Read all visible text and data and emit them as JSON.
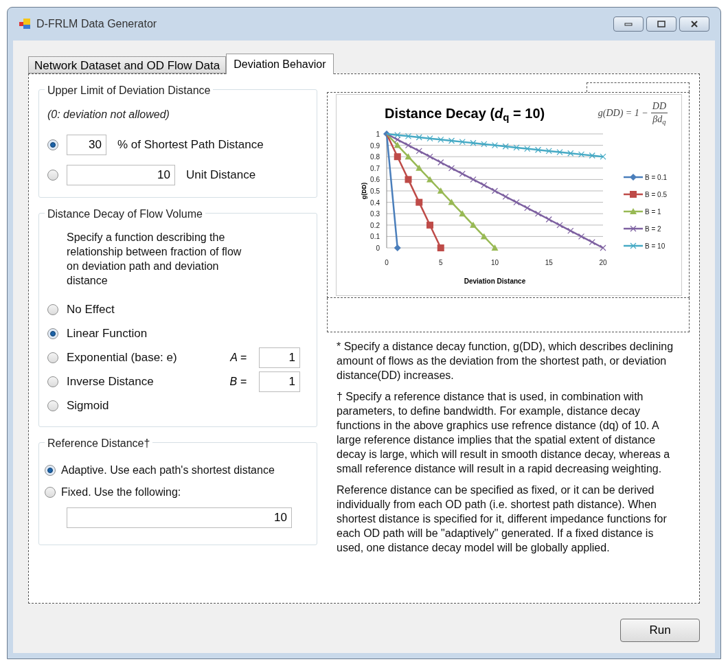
{
  "window": {
    "title": "D-FRLM Data Generator"
  },
  "tabs": [
    {
      "label": "Network Dataset and OD Flow Data",
      "selected": false
    },
    {
      "label": "Deviation Behavior",
      "selected": true
    }
  ],
  "upper_limit": {
    "title": "Upper Limit of Deviation Distance",
    "note": "(0: deviation not allowed)",
    "options": [
      {
        "selected": true,
        "value": "30",
        "label": "% of Shortest Path Distance"
      },
      {
        "selected": false,
        "value": "10",
        "label": "Unit Distance"
      }
    ]
  },
  "distance_decay": {
    "title": "Distance Decay of Flow Volume",
    "description": "Specify a function describing the relationship between fraction of flow on deviation path and deviation distance",
    "options": [
      {
        "label": "No Effect",
        "selected": false
      },
      {
        "label": "Linear Function",
        "selected": true
      },
      {
        "label": "Exponential (base: e)",
        "selected": false
      },
      {
        "label": "Inverse Distance",
        "selected": false
      },
      {
        "label": "Sigmoid",
        "selected": false
      }
    ],
    "parameters": [
      {
        "label": "A =",
        "value": "1"
      },
      {
        "label": "B =",
        "value": "1"
      }
    ]
  },
  "reference_distance": {
    "title": "Reference Distance†",
    "options": [
      {
        "label": "Adaptive. Use each path's shortest distance",
        "selected": true
      },
      {
        "label": "Fixed. Use the following:",
        "selected": false
      }
    ],
    "value": "10"
  },
  "chart": {
    "formula": {
      "lhs": "g(DD) = 1 −",
      "numerator": "DD",
      "denominator": "βd$_{q}$"
    },
    "chart_data": {
      "type": "line",
      "title": "Distance Decay (*d*$_{q}$ = 10)",
      "xlabel": "Deviation Distance",
      "ylabel": "g(DD)",
      "x": [
        0,
        1,
        2,
        3,
        4,
        5,
        6,
        7,
        8,
        9,
        10,
        11,
        12,
        13,
        14,
        15,
        16,
        17,
        18,
        19,
        20
      ],
      "series": [
        {
          "name": "B = 0.1",
          "color": "#4a7ebb",
          "marker": "diamond",
          "values": [
            1,
            0,
            null,
            null,
            null,
            null,
            null,
            null,
            null,
            null,
            null,
            null,
            null,
            null,
            null,
            null,
            null,
            null,
            null,
            null,
            null
          ]
        },
        {
          "name": "B = 0.5",
          "color": "#be4b48",
          "marker": "square",
          "values": [
            1,
            0.8,
            0.6,
            0.4,
            0.2,
            0,
            null,
            null,
            null,
            null,
            null,
            null,
            null,
            null,
            null,
            null,
            null,
            null,
            null,
            null,
            null
          ]
        },
        {
          "name": "B = 1",
          "color": "#98b954",
          "marker": "triangle",
          "values": [
            1,
            0.9,
            0.8,
            0.7,
            0.6,
            0.5,
            0.4,
            0.3,
            0.2,
            0.1,
            0,
            null,
            null,
            null,
            null,
            null,
            null,
            null,
            null,
            null,
            null
          ]
        },
        {
          "name": "B = 2",
          "color": "#7d60a0",
          "marker": "cross",
          "values": [
            1,
            0.95,
            0.9,
            0.85,
            0.8,
            0.75,
            0.7,
            0.65,
            0.6,
            0.55,
            0.5,
            0.45,
            0.4,
            0.35,
            0.3,
            0.25,
            0.2,
            0.15,
            0.1,
            0.05,
            0
          ]
        },
        {
          "name": "B = 10",
          "color": "#46aac5",
          "marker": "cross",
          "values": [
            1,
            0.99,
            0.98,
            0.97,
            0.96,
            0.95,
            0.94,
            0.93,
            0.92,
            0.91,
            0.9,
            0.89,
            0.88,
            0.87,
            0.86,
            0.85,
            0.84,
            0.83,
            0.82,
            0.81,
            0.8
          ]
        }
      ],
      "grid": true,
      "legend": true,
      "xlim": [
        0,
        20
      ],
      "ylim": [
        0,
        1
      ],
      "xticks": [
        0,
        5,
        10,
        15,
        20
      ],
      "yticks": [
        0,
        0.1,
        0.2,
        0.3,
        0.4,
        0.5,
        0.6,
        0.7,
        0.8,
        0.9,
        1
      ]
    }
  },
  "notes": [
    "* Specify a distance decay function, g(DD), which describes declining amount of flows as the deviation from the shortest path, or deviation distance(DD) increases.",
    "† Specify a reference distance that is used, in combination with parameters, to define bandwidth. For example, distance decay functions in the above graphics use refrence distance (dq) of 10. A large reference distance implies that the spatial extent of distance decay is large, which will result in smooth distance decay, whereas a small reference distance will result in a rapid decreasing weighting.",
    "Reference distance can be specified as fixed, or it can be derived individually from each OD path (i.e. shortest path distance). When shortest distance is specified for it, different impedance functions for each OD path will be \"adaptively\" generated. If a fixed distance is used, one distance decay model will be globally applied."
  ],
  "run_button": "Run"
}
